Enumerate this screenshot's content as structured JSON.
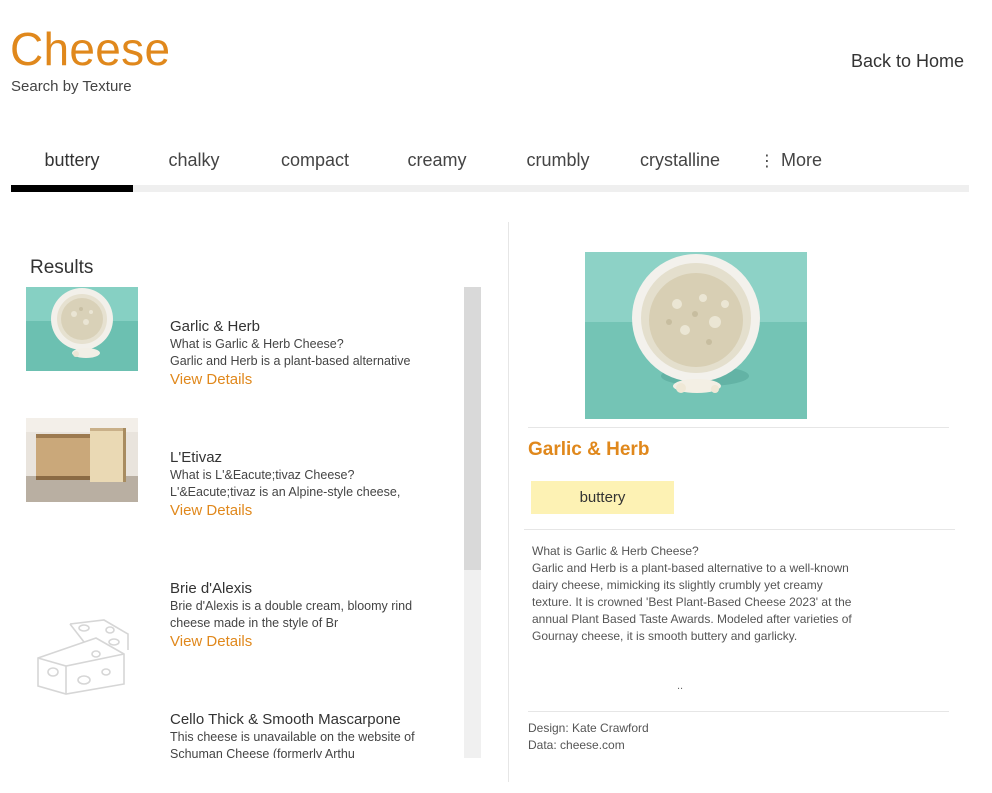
{
  "header": {
    "title": "Cheese",
    "subtitle": "Search by Texture",
    "back_link": "Back to Home"
  },
  "tabs": {
    "items": [
      "buttery",
      "chalky",
      "compact",
      "creamy",
      "crumbly",
      "crystalline"
    ],
    "active": "buttery",
    "more_label": "More",
    "more_icon": "more-vertical-icon"
  },
  "results": {
    "title": "Results",
    "link_label": "View Details",
    "items": [
      {
        "name": "Garlic & Herb",
        "line1": "What is Garlic & Herb Cheese?",
        "line2": "Garlic and Herb is a plant-based alternative",
        "image": "cheese-bowl-photo"
      },
      {
        "name": "L'Etivaz",
        "line1": "What is L'&Eacute;tivaz Cheese?",
        "line2": "L'&Eacute;tivaz is an Alpine-style cheese,",
        "image": "cheese-wedge-photo"
      },
      {
        "name": "Brie d'Alexis",
        "line1": "Brie d'Alexis is a double cream, bloomy rind",
        "line2": "cheese made in the style of Br",
        "image": "cheese-placeholder-icon"
      },
      {
        "name": "Cello Thick & Smooth Mascarpone",
        "line1": "This cheese is unavailable on the website of",
        "line2": "Schuman Cheese (formerly Arthu",
        "image": "none"
      }
    ]
  },
  "detail": {
    "name": "Garlic & Herb",
    "texture": "buttery",
    "question": "What is Garlic & Herb Cheese?",
    "body_lines": [
      "Garlic and Herb is a plant-based alternative to a well-known",
      "dairy cheese, mimicking its slightly crumbly yet creamy",
      "texture. It is crowned 'Best Plant-Based Cheese 2023' at the",
      "annual Plant Based Taste Awards. Modeled after varieties of",
      "Gournay cheese, it is smooth buttery and garlicky."
    ],
    "ellipsis": "..",
    "credit_design": "Design: Kate Crawford",
    "credit_data": "Data: cheese.com"
  },
  "colors": {
    "accent": "#e0881c",
    "badge": "#fdf2b4",
    "photo_background": "#7ecdbf"
  }
}
